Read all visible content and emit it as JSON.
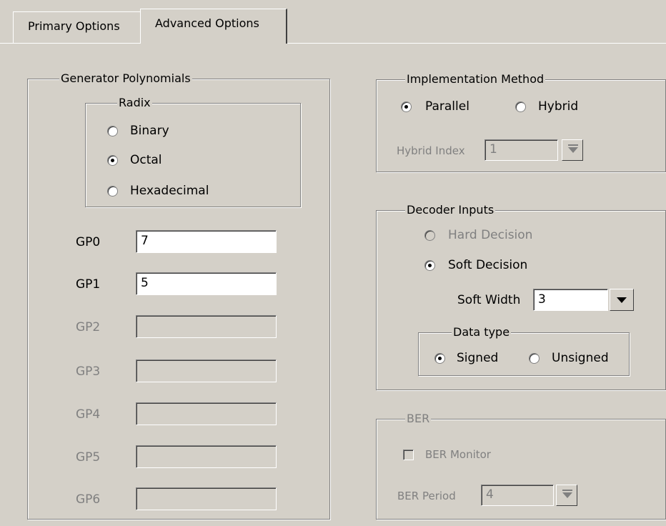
{
  "tabs": [
    {
      "label": "Primary Options"
    },
    {
      "label": "Advanced Options"
    }
  ],
  "generator": {
    "title": "Generator Polynomials",
    "radix": {
      "title": "Radix",
      "options": [
        "Binary",
        "Octal",
        "Hexadecimal"
      ],
      "selected": "Octal"
    },
    "fields": [
      {
        "label": "GP0",
        "value": "7",
        "enabled": true
      },
      {
        "label": "GP1",
        "value": "5",
        "enabled": true
      },
      {
        "label": "GP2",
        "value": "",
        "enabled": false
      },
      {
        "label": "GP3",
        "value": "",
        "enabled": false
      },
      {
        "label": "GP4",
        "value": "",
        "enabled": false
      },
      {
        "label": "GP5",
        "value": "",
        "enabled": false
      },
      {
        "label": "GP6",
        "value": "",
        "enabled": false
      }
    ]
  },
  "implementation": {
    "title": "Implementation Method",
    "options": [
      "Parallel",
      "Hybrid"
    ],
    "selected": "Parallel",
    "hybrid_index_label": "Hybrid Index",
    "hybrid_index_value": "1"
  },
  "decoder": {
    "title": "Decoder Inputs",
    "hard_label": "Hard Decision",
    "soft_label": "Soft Decision",
    "selected": "Soft Decision",
    "soft_width_label": "Soft Width",
    "soft_width_value": "3",
    "data_type": {
      "title": "Data type",
      "options": [
        "Signed",
        "Unsigned"
      ],
      "selected": "Signed"
    }
  },
  "ber": {
    "title": "BER",
    "monitor_label": "BER Monitor",
    "monitor_checked": false,
    "period_label": "BER Period",
    "period_value": "4"
  }
}
